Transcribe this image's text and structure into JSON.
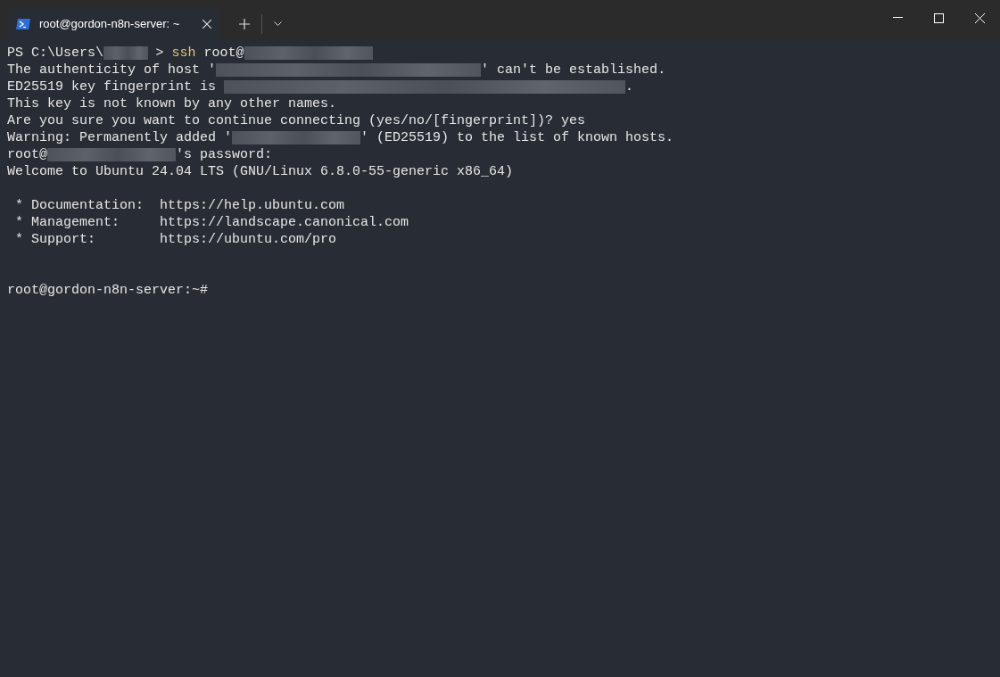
{
  "window": {
    "controls": [
      {
        "kind": "minimize"
      },
      {
        "kind": "maximize"
      },
      {
        "kind": "close"
      }
    ]
  },
  "tabs": [
    {
      "title": "root@gordon-n8n-server: ~",
      "selected": true
    }
  ],
  "terminal": {
    "lines": [
      {
        "kind": "output",
        "segments": [
          {
            "kind": "text",
            "text": "PS C:\\Users\\"
          },
          {
            "kind": "redacted-xs"
          },
          {
            "kind": "text",
            "text": " > "
          },
          {
            "kind": "command",
            "text": "ssh"
          },
          {
            "kind": "text",
            "text": " root@"
          },
          {
            "kind": "redacted-m"
          }
        ]
      },
      {
        "kind": "output",
        "segments": [
          {
            "kind": "text",
            "text": "The authenticity of host '"
          },
          {
            "kind": "redacted-l"
          },
          {
            "kind": "text",
            "text": "' can't be established."
          }
        ]
      },
      {
        "kind": "output",
        "segments": [
          {
            "kind": "text",
            "text": "ED25519 key fingerprint is "
          },
          {
            "kind": "redacted-xl"
          },
          {
            "kind": "text",
            "text": "."
          }
        ]
      },
      {
        "kind": "output",
        "segments": [
          {
            "kind": "text",
            "text": "This key is not known by any other names."
          }
        ]
      },
      {
        "kind": "output",
        "segments": [
          {
            "kind": "text",
            "text": "Are you sure you want to continue connecting (yes/no/[fingerprint])? yes"
          }
        ]
      },
      {
        "kind": "output",
        "segments": [
          {
            "kind": "text",
            "text": "Warning: Permanently added '"
          },
          {
            "kind": "redacted-m"
          },
          {
            "kind": "text",
            "text": "' (ED25519) to the list of known hosts."
          }
        ]
      },
      {
        "kind": "output",
        "segments": [
          {
            "kind": "text",
            "text": "root@"
          },
          {
            "kind": "redacted-m"
          },
          {
            "kind": "text",
            "text": "'s password:"
          }
        ]
      },
      {
        "kind": "output",
        "segments": [
          {
            "kind": "text",
            "text": "Welcome to Ubuntu 24.04 LTS (GNU/Linux 6.8.0-55-generic x86_64)"
          }
        ]
      },
      {
        "kind": "blank"
      },
      {
        "kind": "output",
        "segments": [
          {
            "kind": "text",
            "text": " * Documentation:  https://help.ubuntu.com"
          }
        ]
      },
      {
        "kind": "output",
        "segments": [
          {
            "kind": "text",
            "text": " * Management:     https://landscape.canonical.com"
          }
        ]
      },
      {
        "kind": "output",
        "segments": [
          {
            "kind": "text",
            "text": " * Support:        https://ubuntu.com/pro"
          }
        ]
      },
      {
        "kind": "blank"
      },
      {
        "kind": "blank"
      },
      {
        "kind": "output",
        "segments": [
          {
            "kind": "text",
            "text": "root@gordon-n8n-server:~#"
          }
        ]
      }
    ]
  }
}
